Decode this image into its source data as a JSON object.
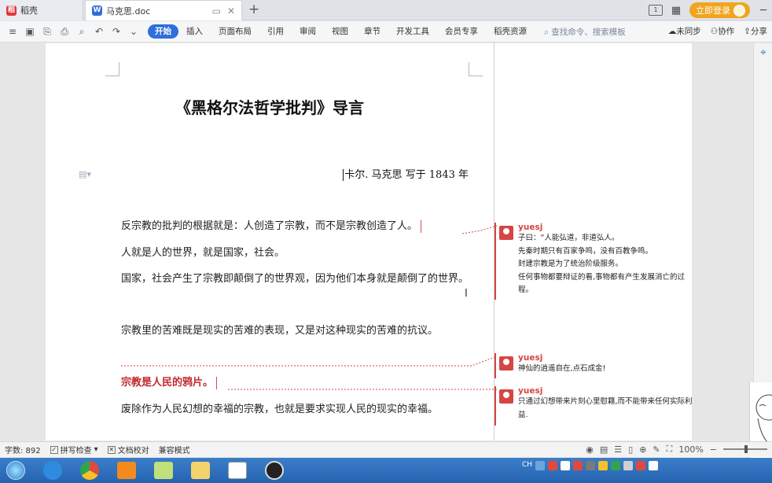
{
  "tabs": {
    "home_label": "稻壳",
    "doc_label": "马克思.doc"
  },
  "topbar": {
    "page_indicator": "1",
    "login_label": "立即登录"
  },
  "ribbon": {
    "menu": [
      "开始",
      "插入",
      "页面布局",
      "引用",
      "审阅",
      "视图",
      "章节",
      "开发工具",
      "会员专享",
      "稻壳资源"
    ],
    "search_placeholder": "查找命令、搜索模板",
    "sync_label": "未同步",
    "collab_label": "协作",
    "share_label": "分享"
  },
  "document": {
    "title": "《黑格尔法哲学批判》导言",
    "author_line": "卡尔. 马克思    写于 1843 年",
    "paragraphs": [
      "反宗教的批判的根据就是：人创造了宗教，而不是宗教创造了人。",
      "人就是人的世界，就是国家，社会。",
      "国家，社会产生了宗教即颠倒了的世界观，因为他们本身就是颠倒了的世界。",
      "宗教里的苦难既是现实的苦难的表现，又是对这种现实的苦难的抗议。",
      "宗教是人民的鸦片。",
      "废除作为人民幻想的幸福的宗教，也就是要求实现人民的现实的幸福。"
    ]
  },
  "comments": [
    {
      "user": "yuesj",
      "text": "子曰：“人能弘道，非道弘人。\n先秦时期只有百家争鸣，没有百教争鸣。\n封建宗教是为了统治阶级服务。\n任何事物都要辩证的看,事物都有产生发展消亡的过程。"
    },
    {
      "user": "yuesj",
      "text": "神仙的逍遥自在,点石成金!"
    },
    {
      "user": "yuesj",
      "text": "只通过幻想带来片刻心里慰籍,而不能带来任何实际利益."
    }
  ],
  "statusbar": {
    "word_count": "字数: 892",
    "spell_check": "拼写检查",
    "proofread": "文档校对",
    "compat_mode": "兼容模式",
    "zoom": "100%"
  },
  "taskbar": {
    "tray_lang": "CH"
  },
  "colors": {
    "accent": "#2f6fd8",
    "comment_red": "#d64545",
    "highlight_text": "#c0282a",
    "login_orange": "#f0a51e"
  }
}
